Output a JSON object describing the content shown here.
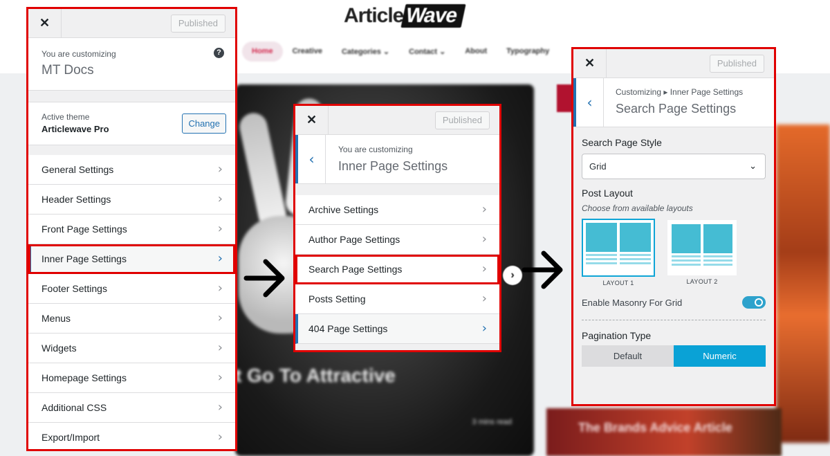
{
  "site": {
    "logo_left": "Article",
    "logo_right": "Wave",
    "nav": [
      "Home",
      "Creative",
      "Categories ⌄",
      "Contact ⌄",
      "About",
      "Typography"
    ],
    "hero_text": "t Go To Attractive",
    "hero_read": "3 mins read",
    "right_card_text": "The Brands Advice Article"
  },
  "panel1": {
    "close": "✕",
    "published": "Published",
    "customizing_label": "You are customizing",
    "customizing_title": "MT Docs",
    "help": "?",
    "active_theme_label": "Active theme",
    "theme_name": "Articlewave Pro",
    "change": "Change",
    "items": [
      {
        "label": "General Settings"
      },
      {
        "label": "Header Settings"
      },
      {
        "label": "Front Page Settings"
      },
      {
        "label": "Inner Page Settings"
      },
      {
        "label": "Footer Settings"
      },
      {
        "label": "Menus"
      },
      {
        "label": "Widgets"
      },
      {
        "label": "Homepage Settings"
      },
      {
        "label": "Additional CSS"
      },
      {
        "label": "Export/Import"
      }
    ]
  },
  "panel2": {
    "close": "✕",
    "published": "Published",
    "customizing_label": "You are customizing",
    "customizing_title": "Inner Page Settings",
    "items": [
      {
        "label": "Archive Settings"
      },
      {
        "label": "Author Page Settings"
      },
      {
        "label": "Search Page Settings"
      },
      {
        "label": "Posts Setting"
      },
      {
        "label": "404 Page Settings"
      }
    ]
  },
  "panel3": {
    "close": "✕",
    "published": "Published",
    "breadcrumb": "Customizing ▸ Inner Page Settings",
    "title": "Search Page Settings",
    "style_label": "Search Page Style",
    "style_value": "Grid",
    "post_layout_label": "Post Layout",
    "post_layout_desc": "Choose from available layouts",
    "layout1": "LAYOUT 1",
    "layout2": "LAYOUT 2",
    "masonry_label": "Enable Masonry For Grid",
    "masonry_on": true,
    "pagination_label": "Pagination Type",
    "pagination_options": [
      "Default",
      "Numeric"
    ],
    "pagination_selected": "Numeric"
  },
  "colors": {
    "highlight_red": "#e00000",
    "wp_blue": "#2271b1",
    "accent_cyan": "#0aa2d6"
  },
  "icons": {
    "close": "close-icon",
    "chevron": "chevron-right-icon",
    "back": "chevron-left-icon",
    "help": "help-icon",
    "arrow": "arrow-right-icon"
  }
}
